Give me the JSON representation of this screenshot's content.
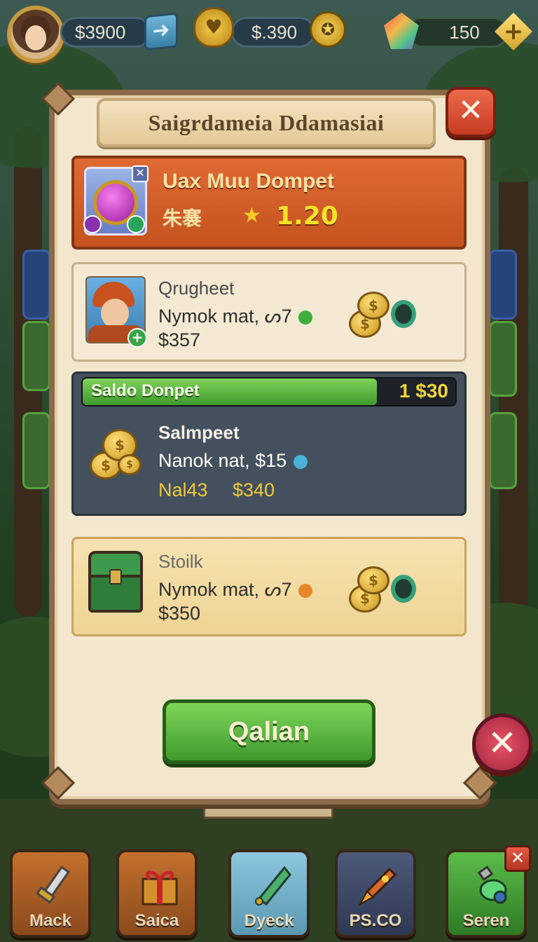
{
  "topbar": {
    "money": "$3900",
    "hearts": "$.390",
    "gems": "150",
    "arrow_glyph": "➜",
    "heart_glyph": "♥",
    "coin_glyph": "✪",
    "plus_glyph": "+"
  },
  "dialog": {
    "title": "Saigrdameia Ddamasiai",
    "close_glyph": "✕",
    "featured": {
      "title": "Uax Muu Dompet",
      "subtitle": "朱褰",
      "star_glyph": "★",
      "price": "1.20",
      "x_glyph": "✕"
    },
    "offers": [
      {
        "title": "Qrugheet",
        "line": "Nymok mat, ᔕ7",
        "price": "$357",
        "dot_color": "#3fae3f"
      },
      {
        "title": "Salmpeet",
        "line": "Nanok nat, $15",
        "price_label": "Nal43",
        "price": "$340",
        "dot_color": "#48b3d6",
        "bar_label": "Saldo Donpet",
        "bar_value": "1 $30",
        "bar_fill": 0.79
      },
      {
        "title": "Stoilk",
        "line": "Nymok mat, ᔕ7",
        "price": "$350",
        "dot_color": "#e7872a"
      }
    ],
    "confirm_label": "Qalian"
  },
  "nav": [
    {
      "label": "Mack",
      "icon": "sword-icon"
    },
    {
      "label": "Saica",
      "icon": "gift-icon"
    },
    {
      "label": "Dyeck",
      "icon": "banner-icon"
    },
    {
      "label": "PS.CO",
      "icon": "rocket-icon"
    },
    {
      "label": "Seren",
      "icon": "potion-icon"
    }
  ],
  "colors": {
    "accent_green": "#4caf34",
    "accent_orange": "#d25c27",
    "panel_bg": "#f2e6cc",
    "close_red": "#d2442c"
  }
}
